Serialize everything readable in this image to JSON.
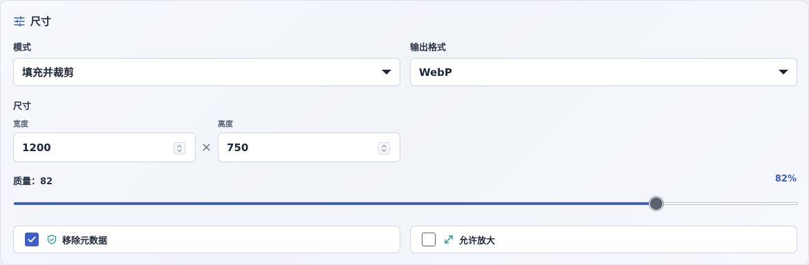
{
  "section": {
    "title": "尺寸",
    "icon": "sliders-icon"
  },
  "mode": {
    "label": "模式",
    "value": "填充并裁剪"
  },
  "output_format": {
    "label": "输出格式",
    "value": "WebP"
  },
  "dimensions": {
    "label": "尺寸",
    "width_label": "宽度",
    "width_value": "1200",
    "times_symbol": "×",
    "height_label": "高度",
    "height_value": "750"
  },
  "quality": {
    "label": "质量：82",
    "percent_text": "82%",
    "value": 82,
    "max": 100
  },
  "options": {
    "strip_metadata": {
      "label": "移除元数据",
      "checked": true,
      "icon": "shield-check-icon"
    },
    "allow_upscale": {
      "label": "允许放大",
      "checked": false,
      "icon": "expand-arrows-icon"
    }
  },
  "colors": {
    "accent": "#3d5fc9",
    "teal": "#1f9a8a"
  }
}
